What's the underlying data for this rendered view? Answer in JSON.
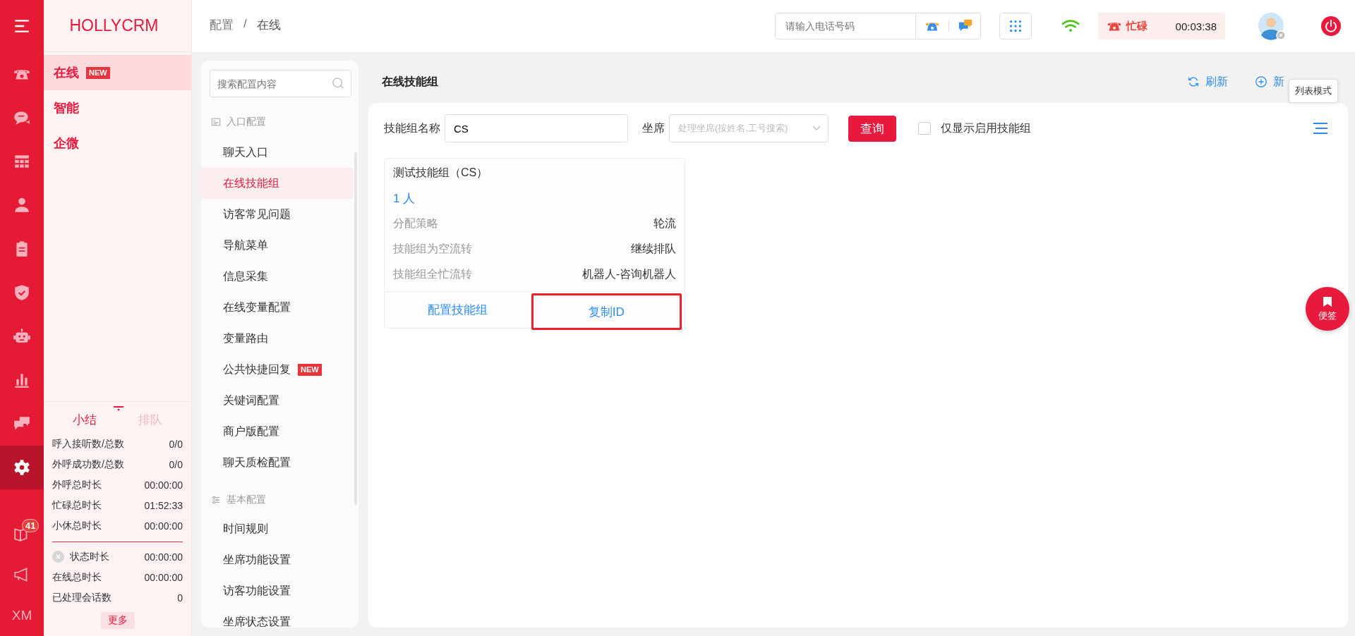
{
  "rail": {
    "items": [
      {
        "selected": false
      },
      {
        "selected": false
      },
      {
        "selected": false
      },
      {
        "selected": false
      },
      {
        "selected": false
      },
      {
        "selected": false
      },
      {
        "selected": false
      },
      {
        "selected": false
      },
      {
        "selected": false
      },
      {
        "selected": true
      }
    ],
    "badge": "41",
    "initials": "XM"
  },
  "sidebar": {
    "brand": "HOLLYCRM",
    "menu": [
      {
        "label": "在线",
        "badge": "NEW",
        "selected": true
      },
      {
        "label": "智能",
        "selected": false
      },
      {
        "label": "企微",
        "selected": false
      }
    ],
    "summary": {
      "tabs": [
        {
          "label": "小结",
          "selected": true
        },
        {
          "label": "排队",
          "selected": false
        }
      ],
      "stats": [
        {
          "label": "呼入接听数/总数",
          "value": "0/0"
        },
        {
          "label": "外呼成功数/总数",
          "value": "0/0"
        },
        {
          "label": "外呼总时长",
          "value": "00:00:00"
        },
        {
          "label": "忙碌总时长",
          "value": "01:52:33"
        },
        {
          "label": "小休总时长",
          "value": "00:00:00"
        }
      ],
      "status_stats": [
        {
          "kind": "status",
          "label": "状态时长",
          "value": "00:00:00"
        },
        {
          "kind": "plain",
          "label": "在线总时长",
          "value": "00:00:00"
        },
        {
          "kind": "plain",
          "label": "已处理会话数",
          "value": "0"
        }
      ],
      "more": "更多"
    }
  },
  "topbar": {
    "breadcrumb": [
      "配置",
      "在线"
    ],
    "separator": "/",
    "phone_input": {
      "placeholder": "请输入电话号码"
    },
    "status": "忙碌",
    "timer": "00:03:38"
  },
  "config_nav": {
    "search": {
      "placeholder": "搜索配置内容"
    },
    "sections": [
      {
        "title": "入口配置",
        "items": [
          {
            "label": "聊天入口",
            "selected": false
          },
          {
            "label": "在线技能组",
            "selected": true
          },
          {
            "label": "访客常见问题",
            "selected": false
          },
          {
            "label": "导航菜单",
            "selected": false
          },
          {
            "label": "信息采集",
            "selected": false
          },
          {
            "label": "在线变量配置",
            "selected": false
          },
          {
            "label": "变量路由",
            "selected": false
          },
          {
            "label": "公共快捷回复",
            "badge": "NEW",
            "selected": false
          },
          {
            "label": "关键词配置",
            "selected": false
          },
          {
            "label": "商户版配置",
            "selected": false
          },
          {
            "label": "聊天质检配置",
            "selected": false
          }
        ]
      },
      {
        "title": "基本配置",
        "items": [
          {
            "label": "时间规则",
            "selected": false
          },
          {
            "label": "坐席功能设置",
            "selected": false
          },
          {
            "label": "访客功能设置",
            "selected": false
          },
          {
            "label": "坐席状态设置",
            "selected": false
          }
        ]
      }
    ]
  },
  "main": {
    "title": "在线技能组",
    "actions": [
      {
        "label": "刷新"
      },
      {
        "label": "新"
      }
    ],
    "tooltip": "列表模式",
    "filter": {
      "name_label": "技能组名称",
      "name_value": "CS",
      "agent_label": "坐席",
      "agent_placeholder": "处理坐席(按姓名,工号搜索)",
      "query": "查询",
      "only_enabled": {
        "label": "仅显示启用技能组",
        "checked": false
      }
    },
    "cards": [
      {
        "title": "测试技能组（CS）",
        "members": "1 人",
        "rows": [
          {
            "label": "分配策略",
            "value": "轮流"
          },
          {
            "label": "技能组为空流转",
            "value": "继续排队"
          },
          {
            "label": "技能组全忙流转",
            "value": "机器人-咨询机器人"
          }
        ],
        "actions": [
          {
            "label": "配置技能组",
            "highlighted": false
          },
          {
            "label": "复制ID",
            "highlighted": true
          }
        ]
      }
    ],
    "note_button": "便签"
  }
}
